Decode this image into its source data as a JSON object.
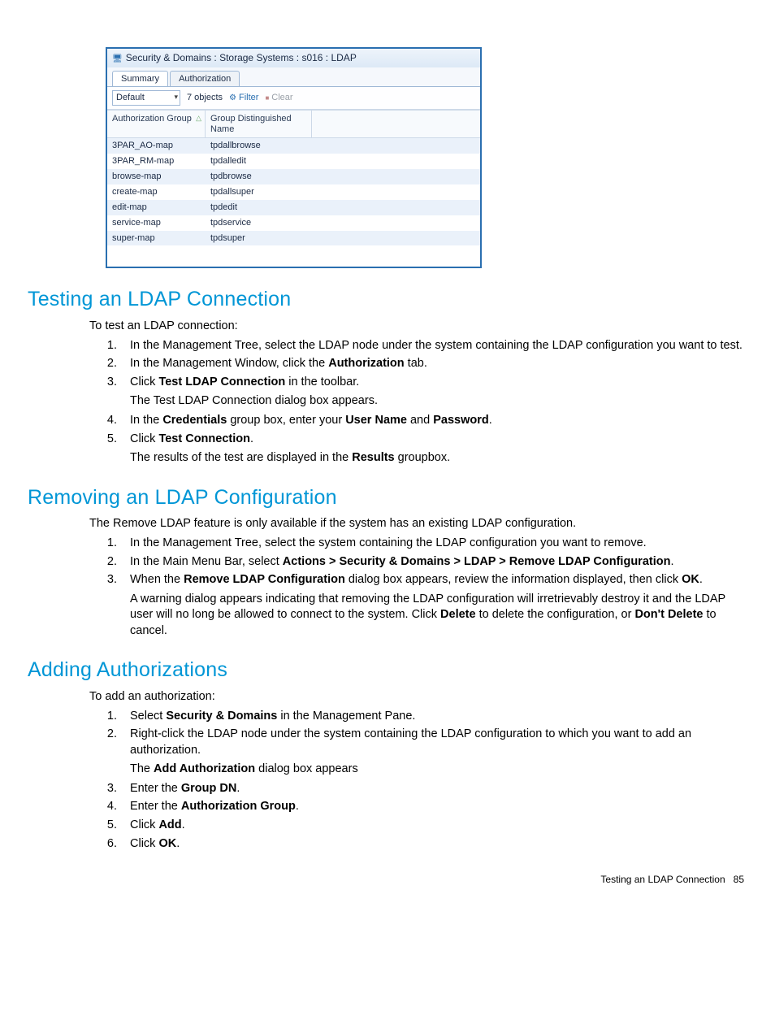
{
  "screenshot": {
    "title": "Security & Domains : Storage Systems : s016 : LDAP",
    "tabs": {
      "summary": "Summary",
      "authorization": "Authorization"
    },
    "toolbar": {
      "select": "Default",
      "count": "7 objects",
      "filter": "Filter",
      "clear": "Clear"
    },
    "headers": {
      "col1": "Authorization Group",
      "col2": "Group Distinguished Name"
    },
    "rows": [
      {
        "c1": "3PAR_AO-map",
        "c2": "tpdallbrowse"
      },
      {
        "c1": "3PAR_RM-map",
        "c2": "tpdalledit"
      },
      {
        "c1": "browse-map",
        "c2": "tpdbrowse"
      },
      {
        "c1": "create-map",
        "c2": "tpdallsuper"
      },
      {
        "c1": "edit-map",
        "c2": "tpdedit"
      },
      {
        "c1": "service-map",
        "c2": "tpdservice"
      },
      {
        "c1": "super-map",
        "c2": "tpdsuper"
      }
    ]
  },
  "sections": {
    "test": {
      "title": "Testing an LDAP Connection",
      "intro": "To test an LDAP connection:",
      "s1": "In the Management Tree, select the LDAP node under the system containing the LDAP configuration you want to test.",
      "s2a": "In the Management Window, click the ",
      "s2b": "Authorization",
      "s2c": " tab.",
      "s3a": "Click ",
      "s3b": "Test LDAP Connection",
      "s3c": " in the toolbar.",
      "s3sub": "The Test LDAP Connection dialog box appears.",
      "s4a": "In the ",
      "s4b": "Credentials",
      "s4c": " group box, enter your ",
      "s4d": "User Name",
      "s4e": " and ",
      "s4f": "Password",
      "s4g": ".",
      "s5a": "Click ",
      "s5b": "Test Connection",
      "s5c": ".",
      "s5sub_a": "The results of the test are displayed in the ",
      "s5sub_b": "Results",
      "s5sub_c": " groupbox."
    },
    "remove": {
      "title": "Removing an LDAP Configuration",
      "intro": "The Remove LDAP feature is only available if the system has an existing LDAP configuration.",
      "s1": "In the Management Tree, select the system containing the LDAP configuration you want to remove.",
      "s2a": "In the Main Menu Bar, select ",
      "s2b": "Actions > Security & Domains > LDAP > Remove LDAP Configuration",
      "s2c": ".",
      "s3a": "When the ",
      "s3b": "Remove LDAP Configuration",
      "s3c": " dialog box appears, review the information displayed, then click ",
      "s3d": "OK",
      "s3e": ".",
      "s3sub_a": "A warning dialog appears indicating that removing the LDAP configuration will irretrievably destroy it and the LDAP user will no long be allowed to connect to the system. Click ",
      "s3sub_b": "Delete",
      "s3sub_c": " to delete the configuration, or ",
      "s3sub_d": "Don't Delete",
      "s3sub_e": " to cancel."
    },
    "add": {
      "title": "Adding Authorizations",
      "intro": "To add an authorization:",
      "s1a": "Select ",
      "s1b": "Security & Domains",
      "s1c": " in the Management Pane.",
      "s2": "Right-click the LDAP node under the system containing the LDAP configuration to which you want to add an authorization.",
      "s2sub_a": "The ",
      "s2sub_b": "Add Authorization",
      "s2sub_c": " dialog box appears",
      "s3a": "Enter the ",
      "s3b": "Group DN",
      "s3c": ".",
      "s4a": "Enter the ",
      "s4b": "Authorization Group",
      "s4c": ".",
      "s5a": "Click ",
      "s5b": "Add",
      "s5c": ".",
      "s6a": "Click ",
      "s6b": "OK",
      "s6c": "."
    }
  },
  "footer": {
    "text": "Testing an LDAP Connection",
    "page": "85"
  }
}
